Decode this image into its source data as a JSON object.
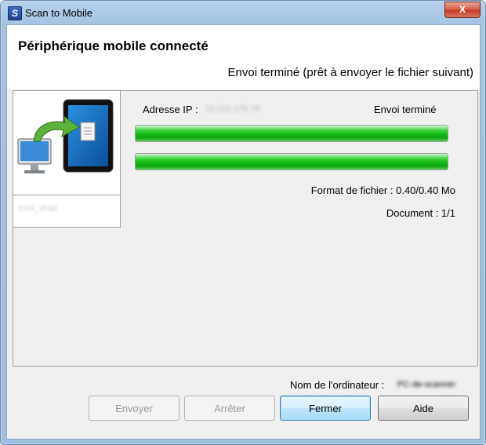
{
  "window": {
    "title": "Scan to Mobile",
    "app_icon_glyph": "S",
    "close_glyph": "X"
  },
  "header": {
    "title": "Périphérique mobile connecté",
    "subtitle": "Envoi terminé (prêt à envoyer le fichier suivant)"
  },
  "device": {
    "name": "XXX_iPad",
    "icon": "mobile-device-send-icon"
  },
  "status": {
    "ip_label": "Adresse IP :",
    "ip_value": "10.232.176.78",
    "state": "Envoi terminé",
    "progress_1": 1.0,
    "progress_2": 1.0,
    "file_format": "Format de fichier : 0.40/0.40 Mo",
    "document": "Document : 1/1"
  },
  "footer": {
    "computer_label": "Nom de l'ordinateur :",
    "computer_value": "PC-de-scanner"
  },
  "buttons": {
    "send": "Envoyer",
    "stop": "Arrêter",
    "close": "Fermer",
    "help": "Aide"
  },
  "colors": {
    "progress": "#14b814",
    "titlebar": "#a5c3e3",
    "close": "#c43c24"
  }
}
